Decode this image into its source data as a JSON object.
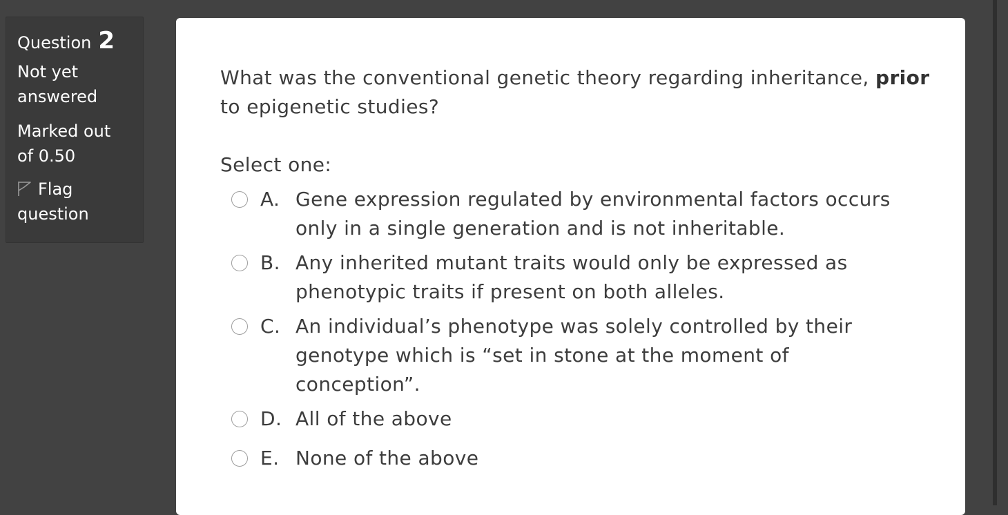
{
  "info": {
    "question_label": "Question",
    "question_number": "2",
    "state": "Not yet answered",
    "grade": "Marked out of 0.50",
    "flag_label": "Flag question"
  },
  "question": {
    "text_before": "What was the conventional genetic theory regarding inheritance,",
    "text_bold": "prior",
    "text_after": "to epigenetic studies?",
    "prompt": "Select one:",
    "options": [
      {
        "letter": "A.",
        "text": "Gene expression regulated by environmental factors occurs only in a single generation and is not inheritable."
      },
      {
        "letter": "B.",
        "text": "Any inherited mutant traits would only be expressed as phenotypic traits if present on both alleles."
      },
      {
        "letter": "C.",
        "text": "An individual’s phenotype was solely controlled by their genotype which is “set in stone at the moment of conception”."
      },
      {
        "letter": "D.",
        "text": "All of the above"
      },
      {
        "letter": "E.",
        "text": "None of the above"
      }
    ]
  },
  "icons": {
    "flag": "flag-outline-icon",
    "radio": "radio-unchecked-icon"
  },
  "colors": {
    "page_background": "#424242",
    "info_box_background": "#3a3a3a",
    "content_background": "#ffffff",
    "text": "#3d3d3d"
  }
}
